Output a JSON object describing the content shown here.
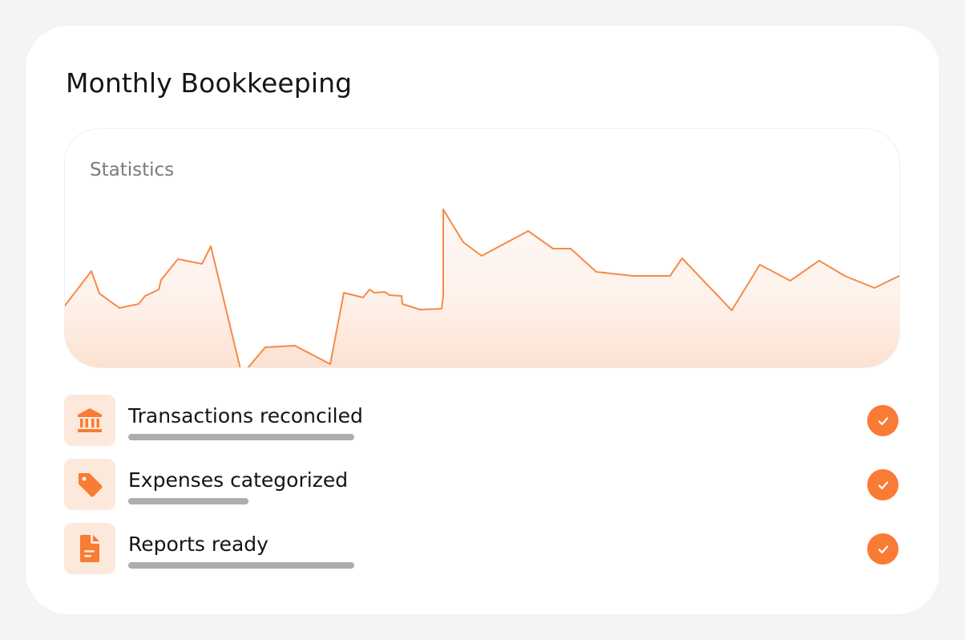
{
  "app": {
    "title": "Monthly Bookkeeping"
  },
  "colors": {
    "accent": "#f97b34",
    "accent_soft": "#fde8dc",
    "bar": "#adadb0"
  },
  "statistics": {
    "label": "Statistics"
  },
  "tasks": [
    {
      "label": "Transactions reconciled",
      "icon": "bank-icon",
      "status": "check-icon",
      "progress": 1.0
    },
    {
      "label": "Expenses categorized",
      "icon": "tag-icon",
      "status": "check-icon",
      "progress": 0.53
    },
    {
      "label": "Reports ready",
      "icon": "document-icon",
      "status": "check-icon",
      "progress": 1.0
    }
  ]
}
